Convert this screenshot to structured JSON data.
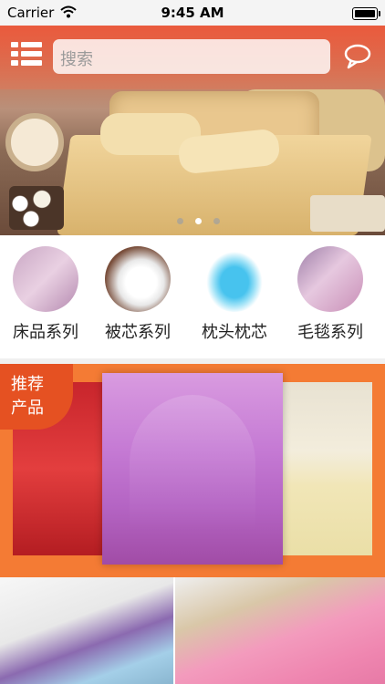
{
  "status_bar": {
    "carrier": "Carrier",
    "time": "9:45 AM"
  },
  "header": {
    "search_placeholder": "搜索"
  },
  "banner": {
    "page_count": 3,
    "active_index": 1
  },
  "categories": [
    {
      "label": "床品系列"
    },
    {
      "label": "被芯系列"
    },
    {
      "label": "枕头枕芯"
    },
    {
      "label": "毛毯系列"
    }
  ],
  "promo": {
    "badge_line1": "推荐",
    "badge_line2": "产品"
  },
  "colors": {
    "accent": "#f47b34",
    "badge": "#e55122"
  },
  "icons": [
    "wifi-icon",
    "battery-icon",
    "menu-icon",
    "chat-bubble-icon"
  ]
}
